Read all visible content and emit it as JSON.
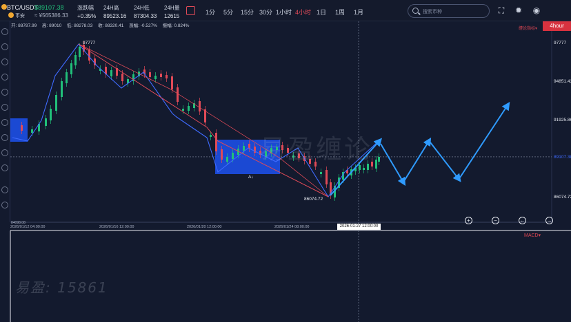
{
  "header": {
    "pair": "BTC/USDT",
    "price": "$89107.38",
    "coin_label": "币安",
    "cny": "≈ ¥565386.33",
    "stats": [
      {
        "label": "涨跌幅",
        "value": "+0.35%"
      },
      {
        "label": "24H高",
        "value": "89523.16"
      },
      {
        "label": "24H低",
        "value": "87304.33"
      },
      {
        "label": "24H量",
        "value": "12615"
      }
    ],
    "timeframes": [
      "1分",
      "5分",
      "15分",
      "30分",
      "1小时",
      "4小时",
      "1日",
      "1周",
      "1月"
    ],
    "active_timeframe": "4小时",
    "search_placeholder": "搜索币种",
    "icons": [
      "fullscreen-icon",
      "brightness-icon",
      "eye-icon"
    ]
  },
  "info_row": {
    "open": "开: 88787.99",
    "high": "高: 89010",
    "low": "低: 88278.03",
    "close": "收: 88320.41",
    "change": "涨幅: -0.527%",
    "amplitude": "振幅: 0.824%"
  },
  "chart_badge": "4hour",
  "indicator_dropdown": "缠论指标▾",
  "macd_label": "MACD▾",
  "watermark": "易盈缠论",
  "watermark_id": "易盈: 15861",
  "chart_data": {
    "type": "candlestick",
    "price_labels": [
      "97777",
      "94851.43",
      "91925.86",
      "89107.38",
      "86074.72"
    ],
    "price_levels": [
      97777,
      94851.43,
      91925.86,
      89107.38,
      86074.72
    ],
    "current_price": 89107.38,
    "annotations": [
      {
        "text": "97777",
        "price": 97777,
        "role": "high"
      },
      {
        "text": "86074.72",
        "price": 86074.72,
        "role": "low"
      },
      {
        "text": "A↓",
        "role": "pivot-label"
      }
    ],
    "time_labels": [
      "2026/01/12 04:00:00",
      "2026/01/16 12:00:00",
      "2026/01/20 12:00:00",
      "2026/01/24 08:00:00",
      "2026-01-27 12:00:00"
    ],
    "highlighted_time": "2026-01-27 12:00:00",
    "bottom_left_label": "84098.08",
    "candle_colors": {
      "up": "#21c07a",
      "down": "#e04a57"
    },
    "stroke_segments": [
      "97777",
      "86074.72"
    ],
    "projection_color": "#2f9bff",
    "pivot_zone_color": "#1d4fe6"
  },
  "zoom_controls": [
    "+",
    "−",
    "←",
    "→"
  ]
}
